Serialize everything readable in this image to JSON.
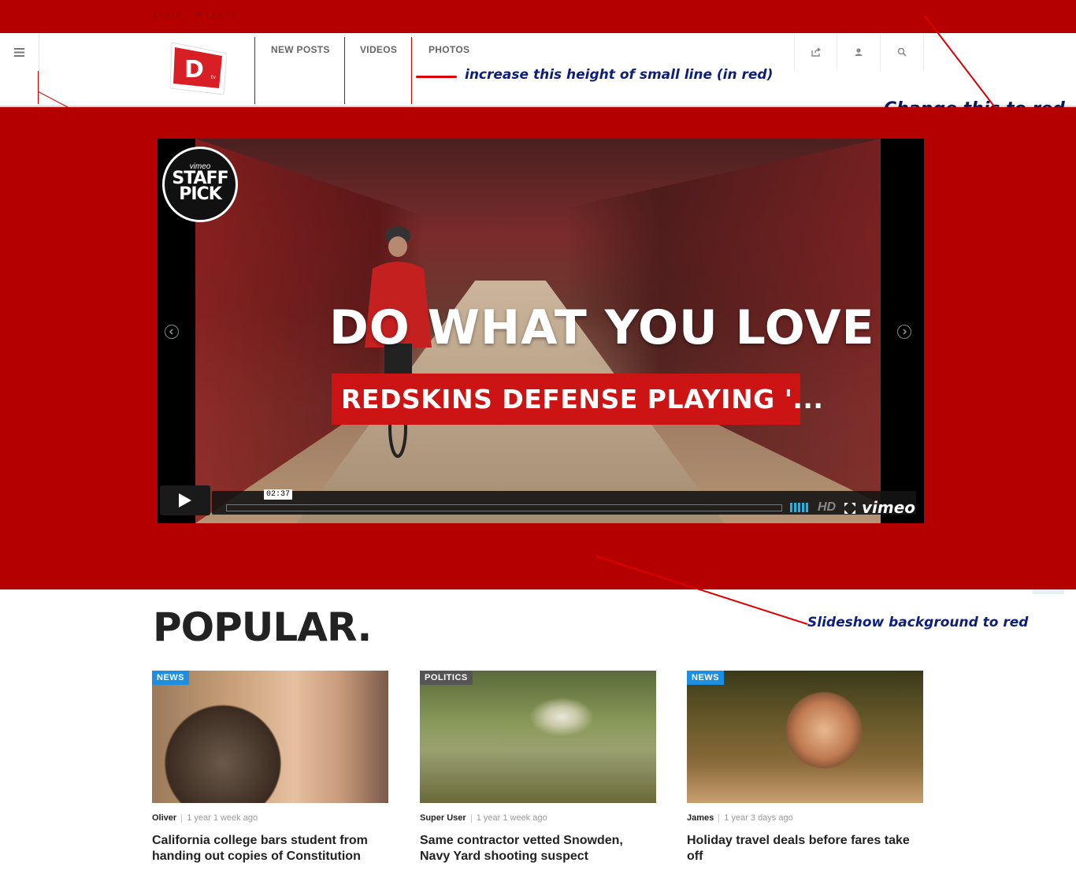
{
  "topbar": {
    "text": "Login · Register"
  },
  "header": {
    "logo_text": "D",
    "nav": [
      "NEW POSTS",
      "VIDEOS",
      "PHOTOS"
    ],
    "icons": [
      "share-icon",
      "user-icon",
      "search-icon"
    ]
  },
  "annotations": {
    "line_height": "increase this height of small line (in red)",
    "change_red": "Change this to red",
    "slideshow_bg": "Slideshow background to red"
  },
  "video": {
    "badge_top": "vimeo",
    "badge_main": "STAFF PICK",
    "headline": "DO WHAT YOU LOVE",
    "caption": "REDSKINS DEFENSE PLAYING '...",
    "time": "02:37",
    "hd": "HD",
    "brand": "vimeo"
  },
  "popular": {
    "title": "POPULAR.",
    "cards": [
      {
        "tag": "NEWS",
        "author": "Oliver",
        "time": "1 year 1 week ago",
        "title": "California college bars student from handing out copies of Constitution"
      },
      {
        "tag": "POLITICS",
        "author": "Super User",
        "time": "1 year 1 week ago",
        "title": "Same contractor vetted Snowden, Navy Yard shooting suspect"
      },
      {
        "tag": "NEWS",
        "author": "James",
        "time": "1 year 3 days ago",
        "title": "Holiday travel deals before fares take off"
      }
    ]
  },
  "colors": {
    "brand_red": "#b40000",
    "tag_blue": "#1e8fe0",
    "annotation_blue": "#0d1f7a"
  }
}
